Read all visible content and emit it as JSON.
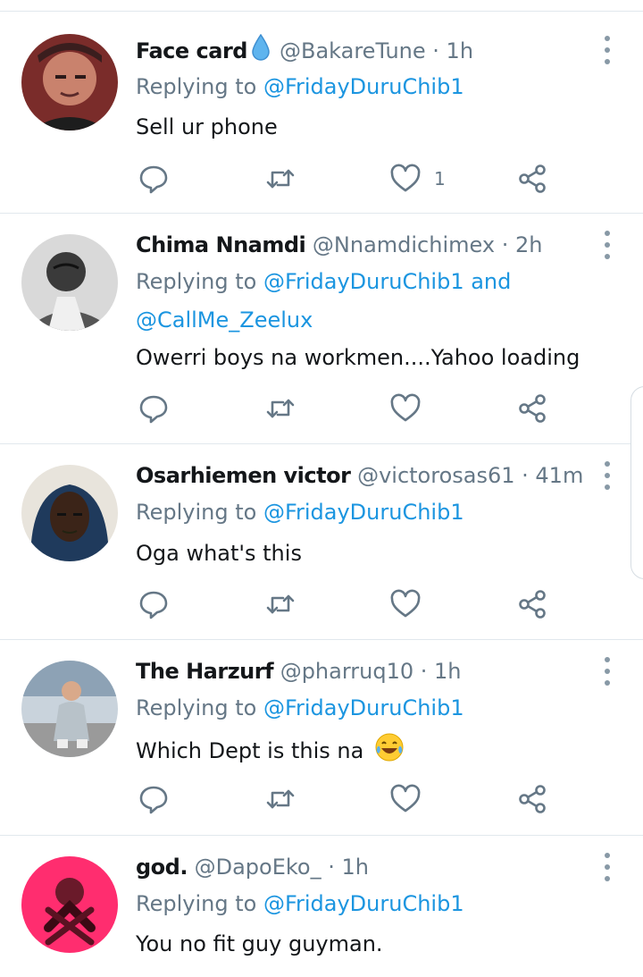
{
  "replies": [
    {
      "name": "Face card",
      "handle": "@BakareTune",
      "time": "· 1h",
      "replying_prefix": "Replying to ",
      "replying_to": "@FridayDuruChib1",
      "replying_extra": "",
      "text": "Sell ur phone",
      "likes": "1",
      "has_name_emoji": true
    },
    {
      "name": "Chima Nnamdi",
      "handle": "@Nnamdichimex",
      "time": "· 2h",
      "replying_prefix": "Replying to ",
      "replying_to": "@FridayDuruChib1",
      "replying_and": " and",
      "replying_extra": "@CallMe_Zeelux",
      "text": "Owerri boys na workmen....Yahoo loading",
      "likes": ""
    },
    {
      "name": "Osarhiemen victor",
      "handle": "@victorosas61",
      "time": "· 41m",
      "replying_prefix": "Replying to ",
      "replying_to": "@FridayDuruChib1",
      "replying_extra": "",
      "text": "Oga what's this",
      "likes": ""
    },
    {
      "name": "The Harzurf",
      "handle": "@pharruq10",
      "time": "· 1h",
      "replying_prefix": "Replying to ",
      "replying_to": "@FridayDuruChib1",
      "replying_extra": "",
      "text": "Which Dept is this na",
      "text_emoji": "laughing-tears-emoji",
      "likes": ""
    },
    {
      "name": "god.",
      "handle": "@DapoEko_",
      "time": "· 1h",
      "replying_prefix": "Replying to ",
      "replying_to": "@FridayDuruChib1",
      "replying_extra": "",
      "text": "You no fit guy guyman.",
      "likes": ""
    }
  ],
  "icons": [
    "reply-icon",
    "retweet-icon",
    "like-icon",
    "share-icon",
    "more-options-icon",
    "water-drop-emoji",
    "laughing-tears-emoji"
  ],
  "colors": {
    "link": "#1b95e0",
    "secondary_text": "#657786",
    "primary_text": "#14171a",
    "divider": "#e1e8ed"
  }
}
